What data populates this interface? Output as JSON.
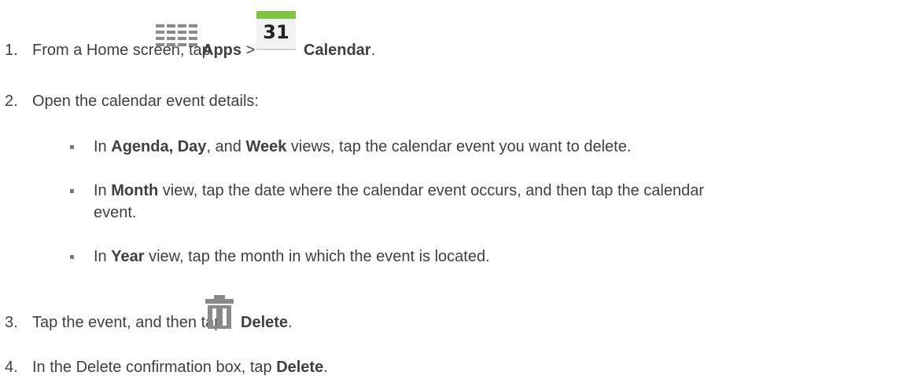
{
  "steps": [
    {
      "number": "1.",
      "parts": {
        "t1": "From a Home screen, tap",
        "b1": "Apps",
        "t2": ">",
        "b2": "Calendar",
        "t3": "."
      },
      "icons": {
        "apps": "apps-grid-icon",
        "calendar": "calendar-icon",
        "calendar_day": "31"
      }
    },
    {
      "number": "2.",
      "text": "Open the calendar event details:"
    },
    {
      "number": "3.",
      "parts": {
        "t1": "Tap the event, and then tap",
        "b1": "Delete",
        "t2": "."
      },
      "icons": {
        "delete": "trash-icon"
      }
    },
    {
      "number": "4.",
      "parts": {
        "t1": "In the Delete confirmation box, tap",
        "b1": "Delete",
        "t2": "."
      }
    }
  ],
  "subitems": [
    {
      "t1": "In",
      "b1": "Agenda, Day",
      "t2": ", and",
      "b2": "Week",
      "t3": "views, tap the calendar event you want to delete."
    },
    {
      "t1": "In",
      "b1": "Month",
      "t2": "view, tap the date where the calendar event occurs, and then tap the calendar",
      "t3": "event."
    },
    {
      "t1": "In",
      "b1": "Year",
      "t2": "view, tap the month in which the event is located."
    }
  ],
  "colors": {
    "text": "#3f3f3f",
    "icon_gray": "#8a8a8a",
    "calendar_green": "#7cc442",
    "calendar_body": "#f2f2f2"
  }
}
